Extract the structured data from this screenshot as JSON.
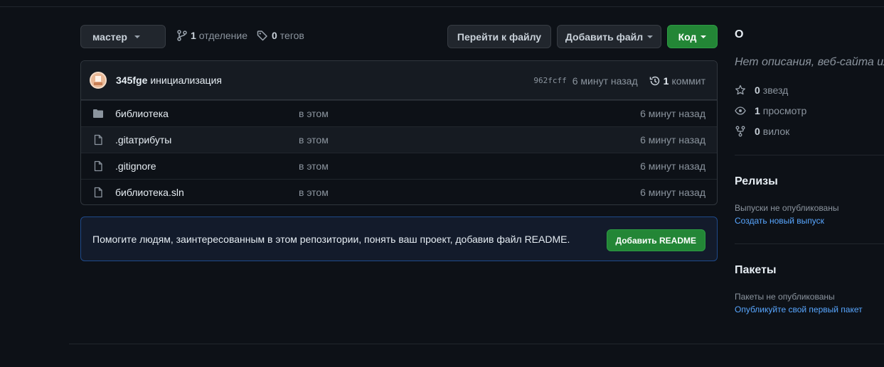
{
  "toolbar": {
    "branch_name": "мастер",
    "branches_count": "1",
    "branches_label": "отделение",
    "tags_count": "0",
    "tags_label": "тегов",
    "goto_file_label": "Перейти к файлу",
    "add_file_label": "Добавить файл",
    "code_label": "Код"
  },
  "commit": {
    "author": "345fge",
    "message": "инициализация",
    "sha": "962fcff",
    "time": "6 минут назад",
    "count": "1",
    "count_label": "коммит"
  },
  "files": [
    {
      "name": "библиотека",
      "type": "folder",
      "message": "в этом",
      "time": "6 минут назад"
    },
    {
      "name": ".gitатрибуты",
      "type": "file",
      "message": "в этом",
      "time": "6 минут назад"
    },
    {
      "name": ".gitignore",
      "type": "file",
      "message": "в этом",
      "time": "6 минут назад"
    },
    {
      "name": "библиотека.sln",
      "type": "file",
      "message": "в этом",
      "time": "6 минут назад"
    }
  ],
  "readme_banner": {
    "text": "Помогите людям, заинтересованным в этом репозитории, понять ваш проект, добавив файл README.",
    "button_label": "Добавить README"
  },
  "sidebar": {
    "about_title": "О",
    "description": "Нет описания, веб-сайта или",
    "stars_count": "0",
    "stars_label": "звезд",
    "watchers_count": "1",
    "watchers_label": "просмотр",
    "forks_count": "0",
    "forks_label": "вилок",
    "releases_title": "Релизы",
    "releases_note": "Выпуски не опубликованы",
    "releases_link": "Создать новый выпуск",
    "packages_title": "Пакеты",
    "packages_note": "Пакеты не опубликованы",
    "packages_link": "Опубликуйте свой первый пакет"
  },
  "colors": {
    "background": "#0d1117",
    "primary_button": "#238636",
    "link": "#58a6ff",
    "banner_border": "#1f4a8a"
  }
}
